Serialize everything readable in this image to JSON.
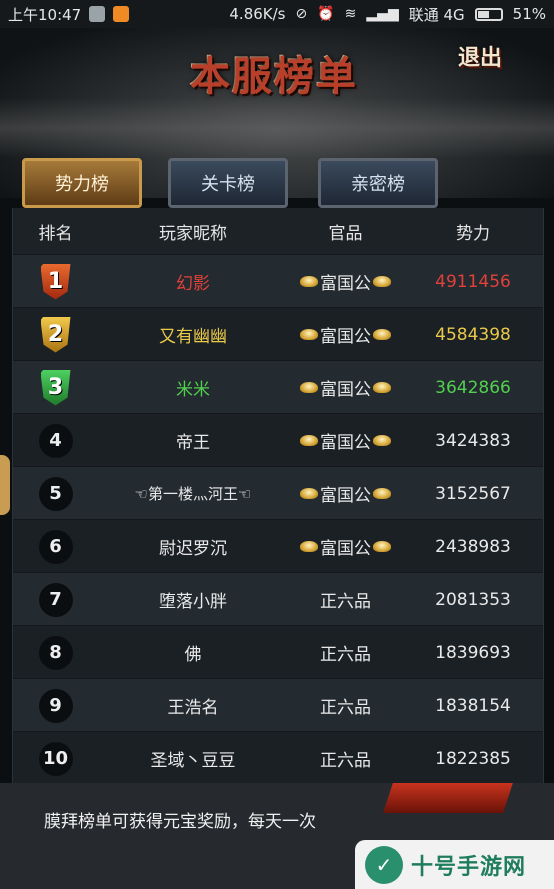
{
  "status_bar": {
    "time": "上午10:47",
    "speed": "4.86K/s",
    "carrier": "联通 4G",
    "battery": "51%",
    "icons": [
      "sim-icon",
      "app-icon",
      "alarm-off-icon",
      "alarm-icon",
      "wifi-icon",
      "signal-icon",
      "battery-icon"
    ]
  },
  "header": {
    "title": "本服榜单",
    "exit_label": "退出"
  },
  "tabs": [
    {
      "label": "势力榜",
      "active": true
    },
    {
      "label": "关卡榜",
      "active": false
    },
    {
      "label": "亲密榜",
      "active": false
    }
  ],
  "table": {
    "columns": [
      "排名",
      "玩家昵称",
      "官品",
      "势力"
    ],
    "rows": [
      {
        "rank": "1",
        "name": "幻影",
        "title": "富国公",
        "power": "4911456",
        "color": "#e0413a"
      },
      {
        "rank": "2",
        "name": "又有幽幽",
        "title": "富国公",
        "power": "4584398",
        "color": "#e9c94a"
      },
      {
        "rank": "3",
        "name": "米米",
        "title": "富国公",
        "power": "3642866",
        "color": "#52d04e"
      },
      {
        "rank": "4",
        "name": "帝王",
        "title": "富国公",
        "power": "3424383",
        "color": "#e9e9e9"
      },
      {
        "rank": "5",
        "name": "☜第一楼灬河王☜",
        "title": "富国公",
        "power": "3152567",
        "color": "#e9e9e9"
      },
      {
        "rank": "6",
        "name": "尉迟罗沉",
        "title": "富国公",
        "power": "2438983",
        "color": "#e9e9e9"
      },
      {
        "rank": "7",
        "name": "堕落小胖",
        "title": "正六品",
        "power": "2081353",
        "color": "#e9e9e9"
      },
      {
        "rank": "8",
        "name": "佛",
        "title": "正六品",
        "power": "1839693",
        "color": "#e9e9e9"
      },
      {
        "rank": "9",
        "name": "王浩名",
        "title": "正六品",
        "power": "1838154",
        "color": "#e9e9e9"
      },
      {
        "rank": "10",
        "name": "圣域丶豆豆",
        "title": "正六品",
        "power": "1822385",
        "color": "#e9e9e9"
      }
    ]
  },
  "footer": {
    "text": "膜拜榜单可获得元宝奖励，每天一次"
  },
  "watermark": {
    "text": "十号手游网"
  }
}
